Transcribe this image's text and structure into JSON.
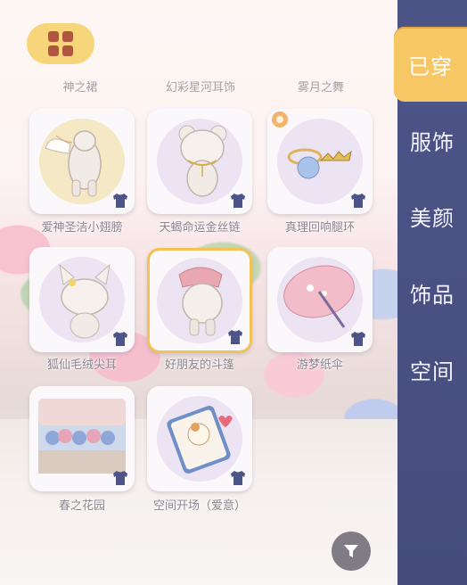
{
  "top_row_labels": [
    "神之裙",
    "幻彩星河耳饰",
    "雾月之舞"
  ],
  "sidebar": {
    "tabs": [
      {
        "label": "已穿",
        "active": true
      },
      {
        "label": "服饰",
        "active": false
      },
      {
        "label": "美颜",
        "active": false
      },
      {
        "label": "饰品",
        "active": false
      },
      {
        "label": "空间",
        "active": false
      }
    ]
  },
  "items": [
    {
      "name": "爱神圣洁小翅膀",
      "icon": "angel-wings-plush",
      "selected": false
    },
    {
      "name": "天蝎命运金丝链",
      "icon": "bear-plush-gold-chain",
      "selected": false
    },
    {
      "name": "真理回响腿环",
      "icon": "leg-ring-crown",
      "selected": false
    },
    {
      "name": "狐仙毛绒尖耳",
      "icon": "fox-ears-plush",
      "selected": false
    },
    {
      "name": "好朋友的斗篷",
      "icon": "cape-plush",
      "selected": true
    },
    {
      "name": "游梦纸伞",
      "icon": "paper-umbrella",
      "selected": false
    },
    {
      "name": "春之花园",
      "icon": "spring-garden-scene",
      "selected": false
    },
    {
      "name": "空间开场（爱意）",
      "icon": "love-card",
      "selected": false
    }
  ],
  "colors": {
    "sidebar": "#4d5488",
    "active_tab": "#f7c765",
    "selected_border": "#f1c356"
  }
}
